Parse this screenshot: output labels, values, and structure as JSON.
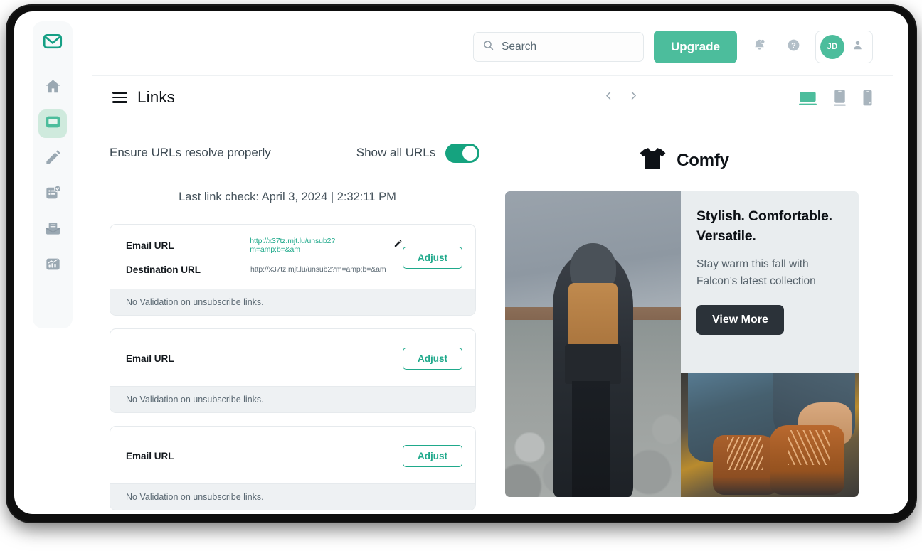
{
  "app": {
    "logo_icon": "mail-logo-icon"
  },
  "sidebar": {
    "items": [
      {
        "name": "home",
        "icon": "home-icon",
        "active": false
      },
      {
        "name": "campaigns",
        "icon": "display-screen-icon",
        "active": true
      },
      {
        "name": "compose",
        "icon": "pencil-icon",
        "active": false
      },
      {
        "name": "checklist",
        "icon": "checklist-check-icon",
        "active": false
      },
      {
        "name": "inbox",
        "icon": "inbox-envelope-icon",
        "active": false
      },
      {
        "name": "analytics",
        "icon": "bar-chart-icon",
        "active": false
      }
    ]
  },
  "topbar": {
    "search": {
      "placeholder": "Search",
      "value": "",
      "icon": "search-icon"
    },
    "upgrade_label": "Upgrade",
    "notifications_icon": "bell-icon",
    "help_icon": "question-circle-icon",
    "avatar_initials": "JD",
    "account_menu_icon": "person-icon"
  },
  "page_header": {
    "menu_icon": "hamburger-icon",
    "title": "Links",
    "prev_icon": "chevron-left-icon",
    "next_icon": "chevron-right-icon",
    "devices": [
      {
        "name": "desktop",
        "icon": "desktop-icon",
        "active": true
      },
      {
        "name": "tablet",
        "icon": "tablet-icon",
        "active": false
      },
      {
        "name": "mobile",
        "icon": "mobile-icon",
        "active": false
      }
    ]
  },
  "main": {
    "ensure_label": "Ensure URLs resolve properly",
    "show_all_label": "Show all URLs",
    "show_all_enabled": true,
    "last_check": "Last link check: April 3, 2024 | 2:32:11 PM",
    "cards": [
      {
        "rows": [
          {
            "key": "Email URL",
            "value": "http://x37tz.mjt.lu/unsub2?m=amp;b=&am",
            "is_link": true,
            "has_edit": true
          },
          {
            "key": "Destination URL",
            "value": "http://x37tz.mjt.lu/unsub2?m=amp;b=&am",
            "is_link": false,
            "has_edit": false
          }
        ],
        "adjust_label": "Adjust",
        "footnote": "No Validation on unsubscribe links."
      },
      {
        "rows": [
          {
            "key": "Email URL",
            "value": "",
            "is_link": false,
            "has_edit": false
          }
        ],
        "adjust_label": "Adjust",
        "footnote": "No Validation on unsubscribe links."
      },
      {
        "rows": [
          {
            "key": "Email URL",
            "value": "",
            "is_link": false,
            "has_edit": false
          }
        ],
        "adjust_label": "Adjust",
        "footnote": "No Validation on unsubscribe links."
      }
    ]
  },
  "preview": {
    "brand_icon": "tshirt-icon",
    "brand_name": "Comfy",
    "headline": "Stylish. Comfortable. Versatile.",
    "subcopy": "Stay warm this fall with Falcon’s latest collection",
    "cta_label": "View More",
    "hero_image_alt": "hiker-with-backpack-photo",
    "secondary_image_alt": "lacing-brown-boots-photo"
  },
  "colors": {
    "accent_teal": "#1fa98b",
    "brand_green": "#4cbd9c",
    "toggle_on": "#15a37f",
    "sidebar_active_bg": "#cfeadd",
    "cta_dark": "#2b3239",
    "card_footer_bg": "#eef1f3"
  }
}
